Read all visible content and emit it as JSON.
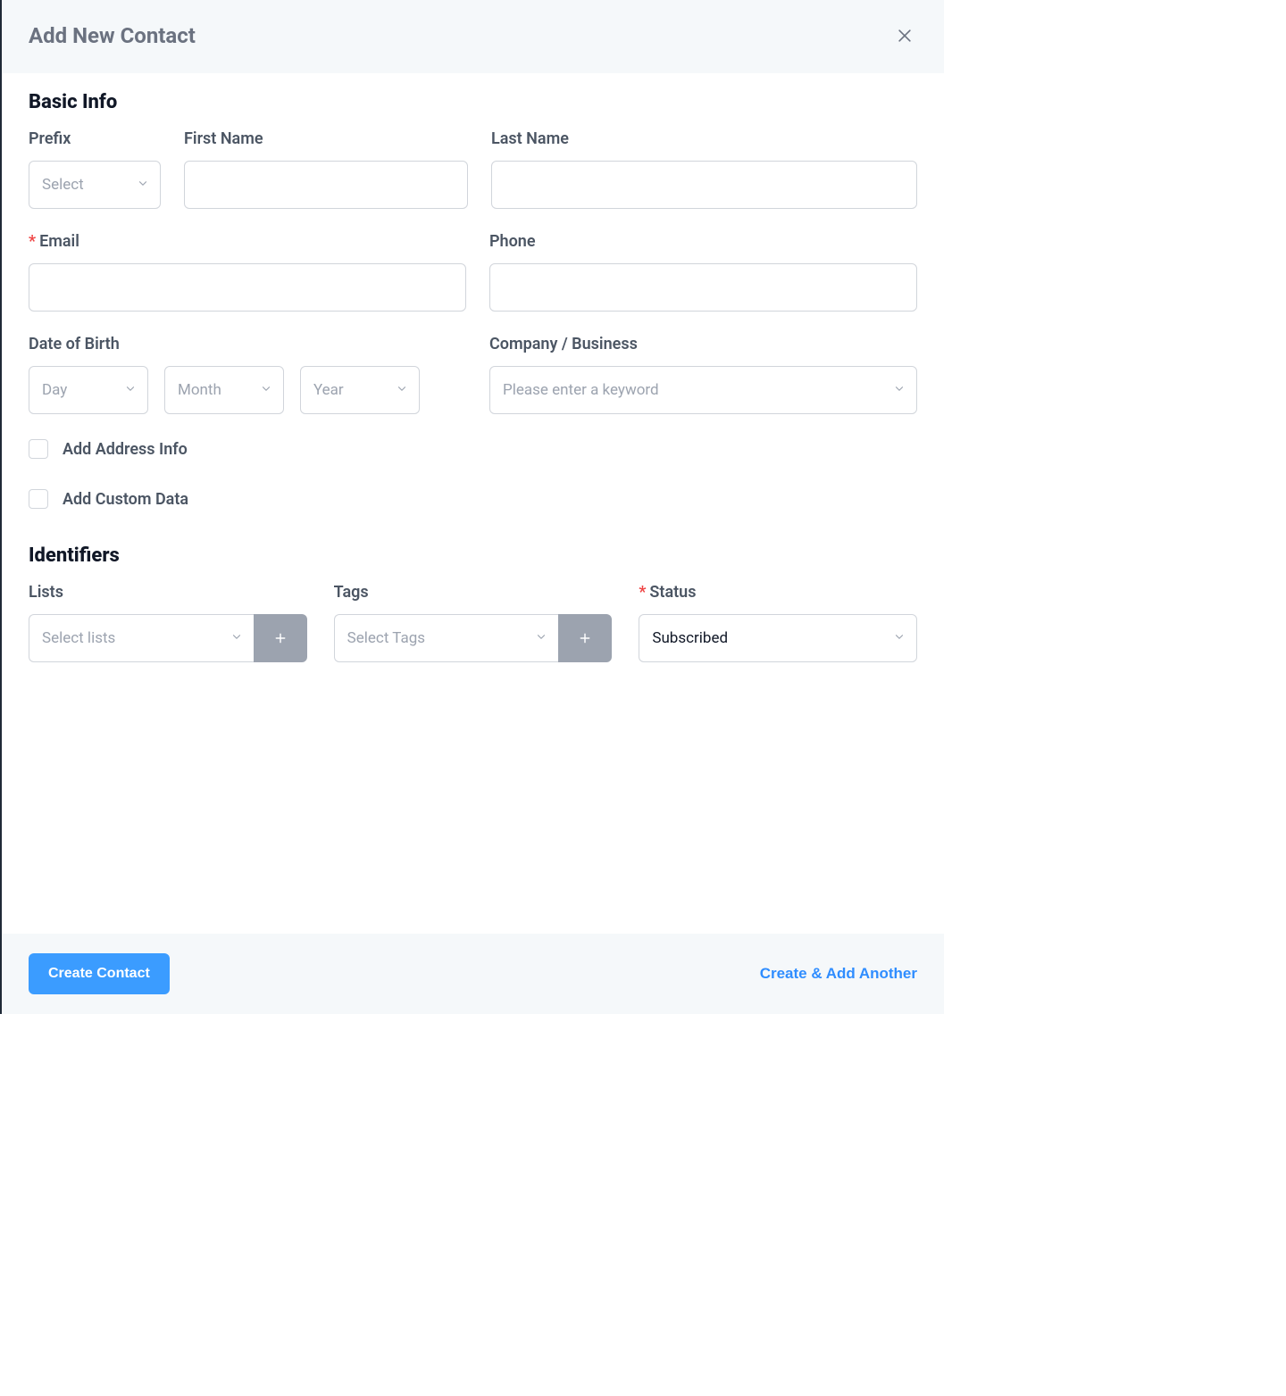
{
  "header": {
    "title": "Add New Contact"
  },
  "sections": {
    "basic_info": {
      "title": "Basic Info",
      "prefix_label": "Prefix",
      "prefix_placeholder": "Select",
      "first_name_label": "First Name",
      "last_name_label": "Last Name",
      "email_label": "Email",
      "phone_label": "Phone",
      "dob_label": "Date of Birth",
      "dob_day_placeholder": "Day",
      "dob_month_placeholder": "Month",
      "dob_year_placeholder": "Year",
      "company_label": "Company / Business",
      "company_placeholder": "Please enter a keyword",
      "add_address_label": "Add Address Info",
      "add_custom_label": "Add Custom Data"
    },
    "identifiers": {
      "title": "Identifiers",
      "lists_label": "Lists",
      "lists_placeholder": "Select lists",
      "tags_label": "Tags",
      "tags_placeholder": "Select Tags",
      "status_label": "Status",
      "status_value": "Subscribed"
    }
  },
  "footer": {
    "create_label": "Create Contact",
    "create_another_label": "Create & Add Another"
  }
}
